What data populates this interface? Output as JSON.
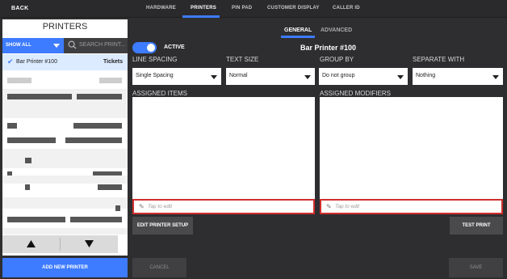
{
  "topbar": {
    "back_label": "BACK",
    "tabs": [
      {
        "label": "HARDWARE"
      },
      {
        "label": "PRINTERS"
      },
      {
        "label": "PIN PAD"
      },
      {
        "label": "CUSTOMER DISPLAY"
      },
      {
        "label": "CALLER ID"
      }
    ]
  },
  "sidebar": {
    "title": "PRINTERS",
    "filter_label": "SHOW ALL",
    "search_placeholder": "SEARCH PRINT...",
    "selected_printer": {
      "name": "Bar Printer #100",
      "type": "Tickets"
    },
    "add_printer_label": "ADD NEW PRINTER"
  },
  "main": {
    "subtabs": [
      {
        "label": "GENERAL"
      },
      {
        "label": "ADVANCED"
      }
    ],
    "active_label": "ACTIVE",
    "printer_title": "Bar Printer #100",
    "fields": [
      {
        "label": "LINE SPACING",
        "value": "Single Spacing"
      },
      {
        "label": "TEXT SIZE",
        "value": "Normal"
      },
      {
        "label": "GROUP BY",
        "value": "Do not group"
      },
      {
        "label": "SEPARATE WITH",
        "value": "Nothing"
      }
    ],
    "assigned_items_label": "ASSIGNED ITEMS",
    "assigned_modifiers_label": "ASSIGNED MODIFIERS",
    "tap_to_edit": "Tap to edit",
    "edit_setup_label": "EDIT PRINTER SETUP",
    "test_print_label": "TEST PRINT",
    "cancel_label": "CANCEL",
    "save_label": "SAVE"
  },
  "colors": {
    "accent": "#3d7bff",
    "background": "#2e2e30",
    "error_border": "#d12e2e"
  }
}
